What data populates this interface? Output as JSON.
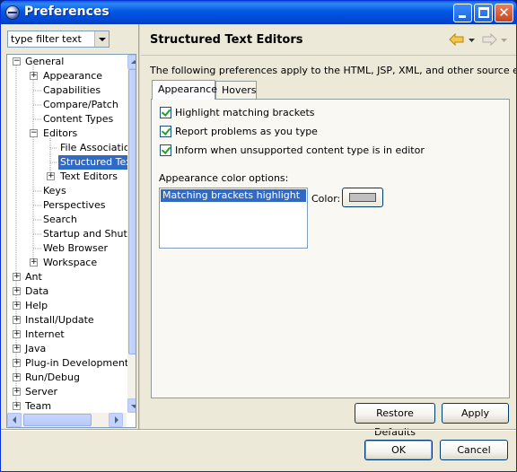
{
  "window": {
    "title": "Preferences"
  },
  "filter": {
    "value": "type filter text"
  },
  "tree": {
    "items": [
      {
        "label": "General",
        "toggle": "−"
      },
      {
        "label": "Appearance",
        "toggle": "+"
      },
      {
        "label": "Capabilities"
      },
      {
        "label": "Compare/Patch"
      },
      {
        "label": "Content Types"
      },
      {
        "label": "Editors",
        "toggle": "−"
      },
      {
        "label": "File Associatio"
      },
      {
        "label": "Structured Tex"
      },
      {
        "label": "Text Editors",
        "toggle": "+"
      },
      {
        "label": "Keys"
      },
      {
        "label": "Perspectives"
      },
      {
        "label": "Search"
      },
      {
        "label": "Startup and Shutd"
      },
      {
        "label": "Web Browser"
      },
      {
        "label": "Workspace",
        "toggle": "+"
      },
      {
        "label": "Ant",
        "toggle": "+"
      },
      {
        "label": "Data",
        "toggle": "+"
      },
      {
        "label": "Help",
        "toggle": "+"
      },
      {
        "label": "Install/Update",
        "toggle": "+"
      },
      {
        "label": "Internet",
        "toggle": "+"
      },
      {
        "label": "Java",
        "toggle": "+"
      },
      {
        "label": "Plug-in Development",
        "toggle": "+"
      },
      {
        "label": "Run/Debug",
        "toggle": "+"
      },
      {
        "label": "Server",
        "toggle": "+"
      },
      {
        "label": "Team",
        "toggle": "+"
      }
    ]
  },
  "page": {
    "title": "Structured Text Editors",
    "description": "The following preferences apply to the HTML, JSP, XML, and other source editors.",
    "tabs": [
      {
        "label": "Appearance"
      },
      {
        "label": "Hovers"
      }
    ],
    "options": [
      {
        "label": "Highlight matching brackets",
        "checked": true
      },
      {
        "label": "Report problems as you type",
        "checked": true
      },
      {
        "label": "Inform when unsupported content type is in editor",
        "checked": true
      }
    ],
    "color_section_label": "Appearance color options:",
    "color_items": [
      "Matching brackets highlight"
    ],
    "color_label": "Color:",
    "selected_color": "#c0c0c0"
  },
  "buttons": {
    "restore_defaults": "Restore Defaults",
    "apply": "Apply",
    "ok": "OK",
    "cancel": "Cancel"
  },
  "colors": {
    "selection": "#316ac5",
    "titlebar": "#0058e6",
    "back_arrow": "#e6b419"
  }
}
